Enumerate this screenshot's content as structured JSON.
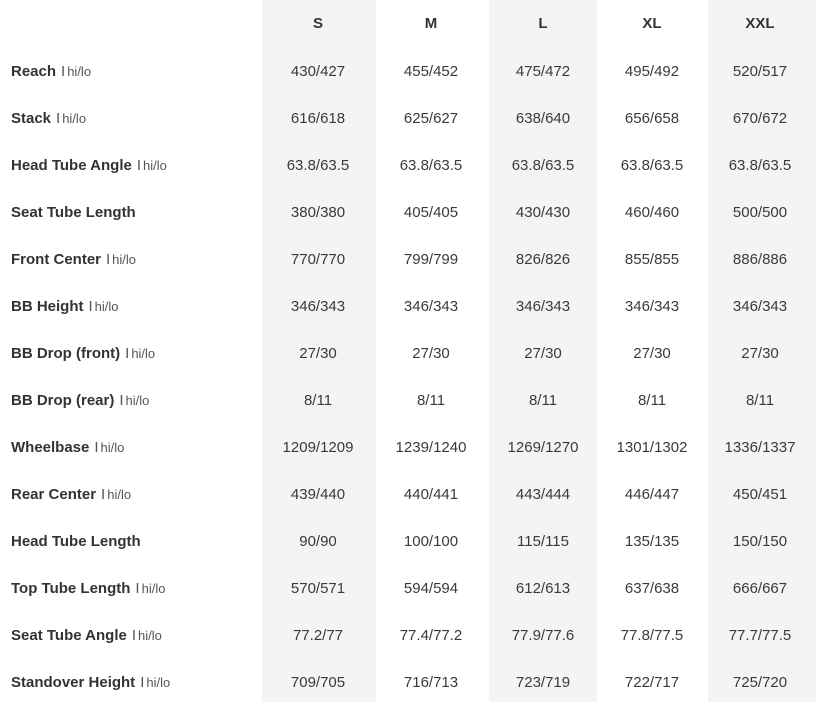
{
  "sizes": [
    "S",
    "M",
    "L",
    "XL",
    "XXL"
  ],
  "rows": [
    {
      "name": "Reach",
      "sep": "I",
      "unit": "hi/lo",
      "values": [
        "430/427",
        "455/452",
        "475/472",
        "495/492",
        "520/517"
      ]
    },
    {
      "name": "Stack",
      "sep": "I",
      "unit": "hi/lo",
      "values": [
        "616/618",
        "625/627",
        "638/640",
        "656/658",
        "670/672"
      ]
    },
    {
      "name": "Head Tube Angle",
      "sep": "I",
      "unit": "hi/lo",
      "values": [
        "63.8/63.5",
        "63.8/63.5",
        "63.8/63.5",
        "63.8/63.5",
        "63.8/63.5"
      ]
    },
    {
      "name": "Seat Tube Length",
      "sep": "",
      "unit": "",
      "values": [
        "380/380",
        "405/405",
        "430/430",
        "460/460",
        "500/500"
      ]
    },
    {
      "name": "Front Center",
      "sep": "I",
      "unit": "hi/lo",
      "values": [
        "770/770",
        "799/799",
        "826/826",
        "855/855",
        "886/886"
      ]
    },
    {
      "name": "BB Height",
      "sep": "I",
      "unit": "hi/lo",
      "values": [
        "346/343",
        "346/343",
        "346/343",
        "346/343",
        "346/343"
      ]
    },
    {
      "name": "BB Drop (front)",
      "sep": "I",
      "unit": "hi/lo",
      "values": [
        "27/30",
        "27/30",
        "27/30",
        "27/30",
        "27/30"
      ]
    },
    {
      "name": "BB Drop (rear)",
      "sep": "I",
      "unit": "hi/lo",
      "values": [
        "8/11",
        "8/11",
        "8/11",
        "8/11",
        "8/11"
      ]
    },
    {
      "name": "Wheelbase",
      "sep": "I",
      "unit": "hi/lo",
      "values": [
        "1209/1209",
        "1239/1240",
        "1269/1270",
        "1301/1302",
        "1336/1337"
      ]
    },
    {
      "name": "Rear Center",
      "sep": "I",
      "unit": "hi/lo",
      "values": [
        "439/440",
        "440/441",
        "443/444",
        "446/447",
        "450/451"
      ]
    },
    {
      "name": "Head Tube Length",
      "sep": "",
      "unit": "",
      "values": [
        "90/90",
        "100/100",
        "115/115",
        "135/135",
        "150/150"
      ]
    },
    {
      "name": "Top Tube Length",
      "sep": "I",
      "unit": "hi/lo",
      "values": [
        "570/571",
        "594/594",
        "612/613",
        "637/638",
        "666/667"
      ]
    },
    {
      "name": "Seat Tube Angle",
      "sep": "I",
      "unit": "hi/lo",
      "values": [
        "77.2/77",
        "77.4/77.2",
        "77.9/77.6",
        "77.8/77.5",
        "77.7/77.5"
      ]
    },
    {
      "name": "Standover Height",
      "sep": "I",
      "unit": "hi/lo",
      "values": [
        "709/705",
        "716/713",
        "723/719",
        "722/717",
        "725/720"
      ]
    }
  ]
}
